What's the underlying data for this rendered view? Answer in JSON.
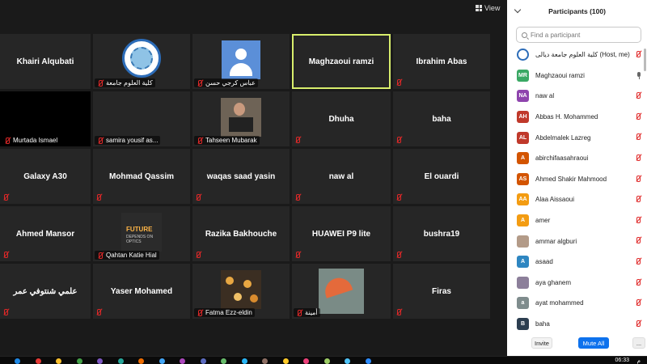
{
  "view_button": {
    "label": "View"
  },
  "tiles": [
    {
      "type": "name",
      "name": "Khairi Alqubati",
      "muted": false
    },
    {
      "type": "pic",
      "pic": "college-logo",
      "caption": "كلية العلوم جامعة",
      "muted": true
    },
    {
      "type": "pic",
      "pic": "default-avatar",
      "caption": "عباس كرجي حسن",
      "muted": true
    },
    {
      "type": "name",
      "name": "Maghzaoui ramzi",
      "active": true,
      "muted": false
    },
    {
      "type": "name",
      "name": "Ibrahim Abas",
      "muted": true
    },
    {
      "type": "black",
      "caption": "Murtada Ismael",
      "muted": true
    },
    {
      "type": "caption-only",
      "caption": "samira yousif as...",
      "muted": true
    },
    {
      "type": "pic",
      "pic": "person-photo",
      "caption": "Tahseen Mubarak",
      "muted": true
    },
    {
      "type": "name",
      "name": "Dhuha",
      "muted": true
    },
    {
      "type": "name",
      "name": "baha",
      "muted": true
    },
    {
      "type": "name",
      "name": "Galaxy A30",
      "muted": true
    },
    {
      "type": "name",
      "name": "Mohmad Qassim",
      "muted": true
    },
    {
      "type": "name",
      "name": "waqas saad yasin",
      "muted": true
    },
    {
      "type": "name",
      "name": "naw al",
      "muted": true
    },
    {
      "type": "name",
      "name": "El ouardi",
      "muted": true
    },
    {
      "type": "name",
      "name": "Ahmed Mansor",
      "muted": true
    },
    {
      "type": "pic",
      "pic": "future-photo",
      "caption": "Qahtan Katie Hial",
      "muted": true,
      "pic_text": "FUTURE",
      "pic_subtext": "DEPENDS ON OPTICS"
    },
    {
      "type": "name",
      "name": "Razika Bakhouche",
      "muted": true
    },
    {
      "type": "name",
      "name": "HUAWEI P9 lite",
      "muted": true
    },
    {
      "type": "name",
      "name": "bushra19",
      "muted": true
    },
    {
      "type": "name",
      "name": "علمي شنتوفي عمر",
      "muted": true
    },
    {
      "type": "name",
      "name": "Yaser Mohamed",
      "muted": true
    },
    {
      "type": "pic",
      "pic": "flowers-photo",
      "caption": "Fatma Ezz-eldin",
      "muted": true
    },
    {
      "type": "pic",
      "pic": "umbrella-photo",
      "caption": "أمينة",
      "muted": true
    },
    {
      "type": "name",
      "name": "Firas",
      "muted": true
    }
  ],
  "panel": {
    "title": "Participants (100)",
    "search_placeholder": "Find a participant",
    "participants": [
      {
        "initials": "",
        "avatar": "logo",
        "color": "#ffffff",
        "name": "كلية العلوم جامعة ديالى (Host, me)",
        "mic": "muted"
      },
      {
        "initials": "MR",
        "color": "#3aa864",
        "name": "Maghzaoui ramzi",
        "mic": "on"
      },
      {
        "initials": "NA",
        "color": "#8e44ad",
        "name": "naw al",
        "mic": "muted"
      },
      {
        "initials": "AH",
        "color": "#c0392b",
        "name": "Abbas H. Mohammed",
        "mic": "muted"
      },
      {
        "initials": "AL",
        "color": "#c0392b",
        "name": "Abdelmalek Lazreg",
        "mic": "muted"
      },
      {
        "initials": "A",
        "color": "#d35400",
        "name": "abirchifaasahraoui",
        "mic": "muted"
      },
      {
        "initials": "AS",
        "color": "#d35400",
        "name": "Ahmed Shakir Mahmood",
        "mic": "muted"
      },
      {
        "initials": "AA",
        "color": "#f39c12",
        "name": "Alaa Aissaoui",
        "mic": "muted"
      },
      {
        "initials": "A",
        "color": "#f39c12",
        "name": "amer",
        "mic": "muted"
      },
      {
        "initials": "",
        "avatar": "photo",
        "color": "#b39b88",
        "name": "ammar algburi",
        "mic": "muted"
      },
      {
        "initials": "A",
        "color": "#2e86c1",
        "name": "asaad",
        "mic": "muted"
      },
      {
        "initials": "",
        "avatar": "photo2",
        "color": "#8c7f9a",
        "name": "aya ghanem",
        "mic": "muted"
      },
      {
        "initials": "a",
        "color": "#7f8c8d",
        "name": "ayat mohammed",
        "mic": "muted"
      },
      {
        "initials": "B",
        "color": "#2c3e50",
        "name": "baha",
        "mic": "muted"
      }
    ],
    "invite_label": "Invite",
    "mute_all_label": "Mute All",
    "more_label": "..."
  },
  "taskbar": {
    "time": "06:33",
    "ampm": "م",
    "icon_colors": [
      "#1e88e5",
      "#e53935",
      "#fbc02d",
      "#43a047",
      "#7e57c2",
      "#26a69a",
      "#ef6c00",
      "#42a5f5",
      "#ab47bc",
      "#5c6bc0",
      "#66bb6a",
      "#29b6f6",
      "#8d6e63",
      "#ffca28",
      "#ec407a",
      "#9ccc65",
      "#4fc3f7",
      "#2d8cff"
    ]
  }
}
